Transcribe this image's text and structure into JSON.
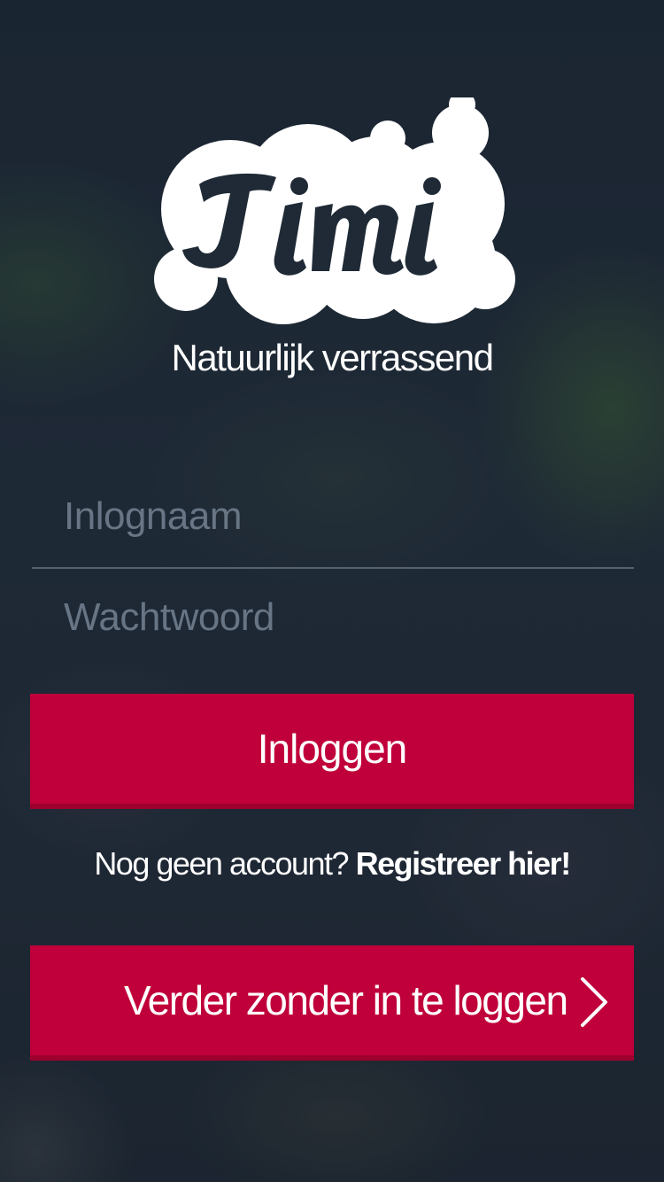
{
  "brand": {
    "logo_text": "Jimi",
    "tagline": "Natuurlijk verrassend"
  },
  "login_form": {
    "username_placeholder": "Inlognaam",
    "password_placeholder": "Wachtwoord",
    "login_button": "Inloggen"
  },
  "register": {
    "prompt": "Nog geen account?",
    "link": "Registreer hier!"
  },
  "guest": {
    "button_label": "Verder zonder in te loggen",
    "icon": "chevron-right-icon"
  },
  "colors": {
    "primary_button": "#c0003a",
    "button_shadow": "#9e002e",
    "background": "#1f2a36",
    "text": "#ffffff"
  }
}
